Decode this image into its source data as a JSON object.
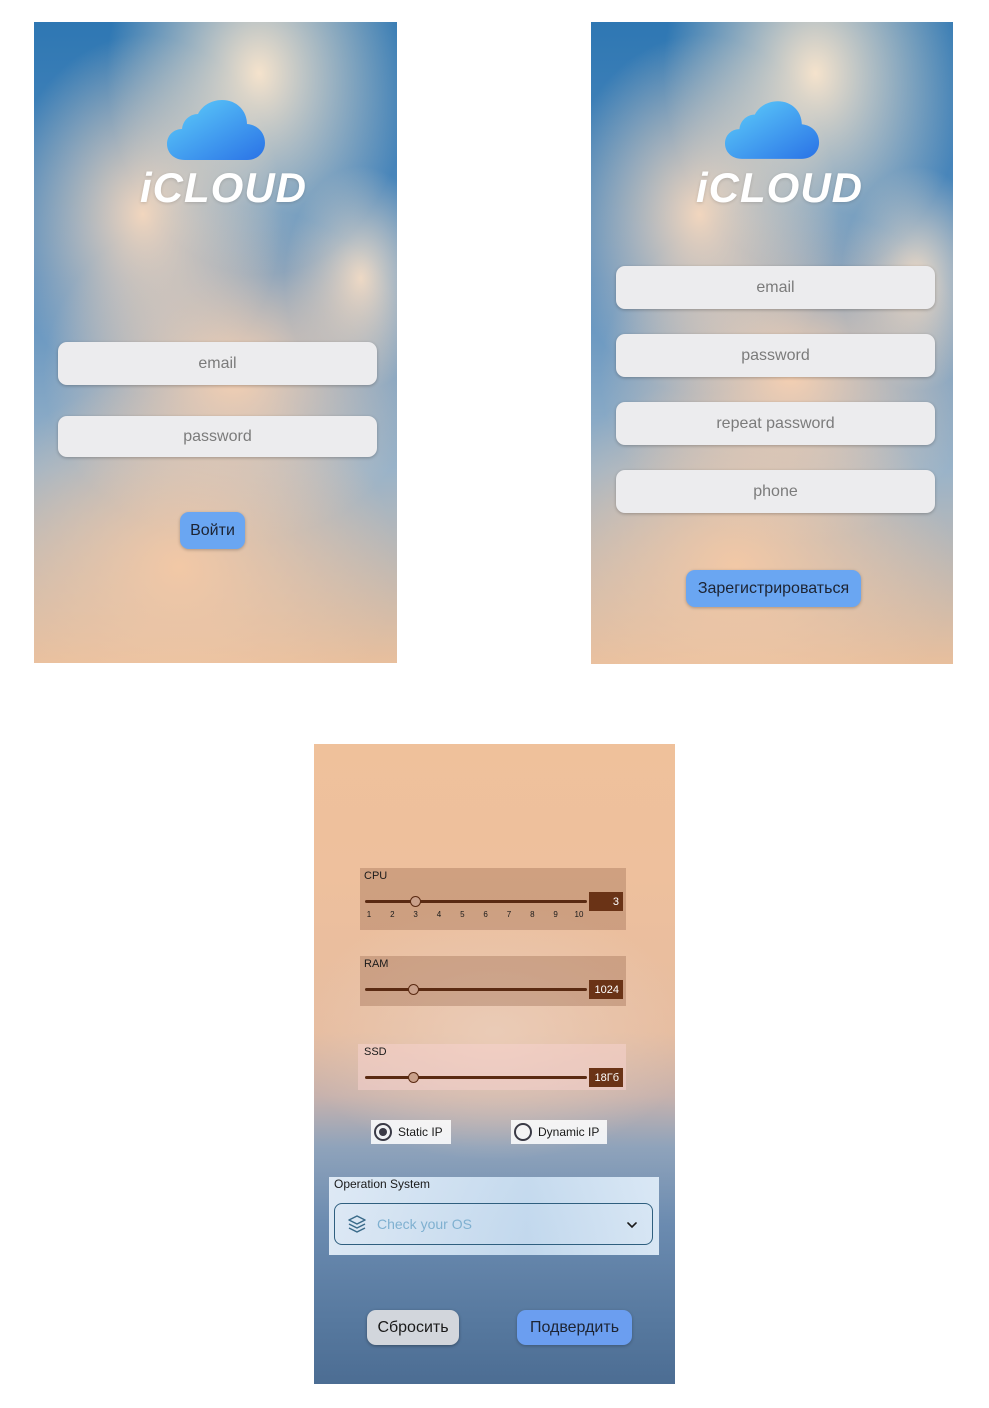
{
  "login": {
    "brand": "iCLOUD",
    "email_placeholder": "email",
    "password_placeholder": "password",
    "submit_label": "Войти"
  },
  "register": {
    "brand": "iCLOUD",
    "email_placeholder": "email",
    "password_placeholder": "password",
    "repeat_password_placeholder": "repeat password",
    "phone_placeholder": "phone",
    "submit_label": "Зарегистрироваться"
  },
  "config": {
    "cpu": {
      "label": "CPU",
      "value_text": "3",
      "value": 3,
      "min": 1,
      "max": 10,
      "ticks": [
        "1",
        "2",
        "3",
        "4",
        "5",
        "6",
        "7",
        "8",
        "9",
        "10"
      ]
    },
    "ram": {
      "label": "RAM",
      "value_text": "1024",
      "level": 0.22
    },
    "ssd": {
      "label": "SSD",
      "value_text": "18Гб",
      "level": 0.22
    },
    "ip": {
      "static_label": "Static IP",
      "dynamic_label": "Dynamic IP",
      "selected": "static"
    },
    "os": {
      "title": "Operation System",
      "placeholder": "Check your OS"
    },
    "reset_label": "Сбросить",
    "confirm_label": "Подвердить"
  },
  "colors": {
    "accent_blue": "#6aa6f2",
    "slider_brown": "#5a2a12",
    "field_bg": "#ececee"
  },
  "icons": [
    "cloud-logo-icon",
    "layers-icon",
    "chevron-down-icon"
  ]
}
